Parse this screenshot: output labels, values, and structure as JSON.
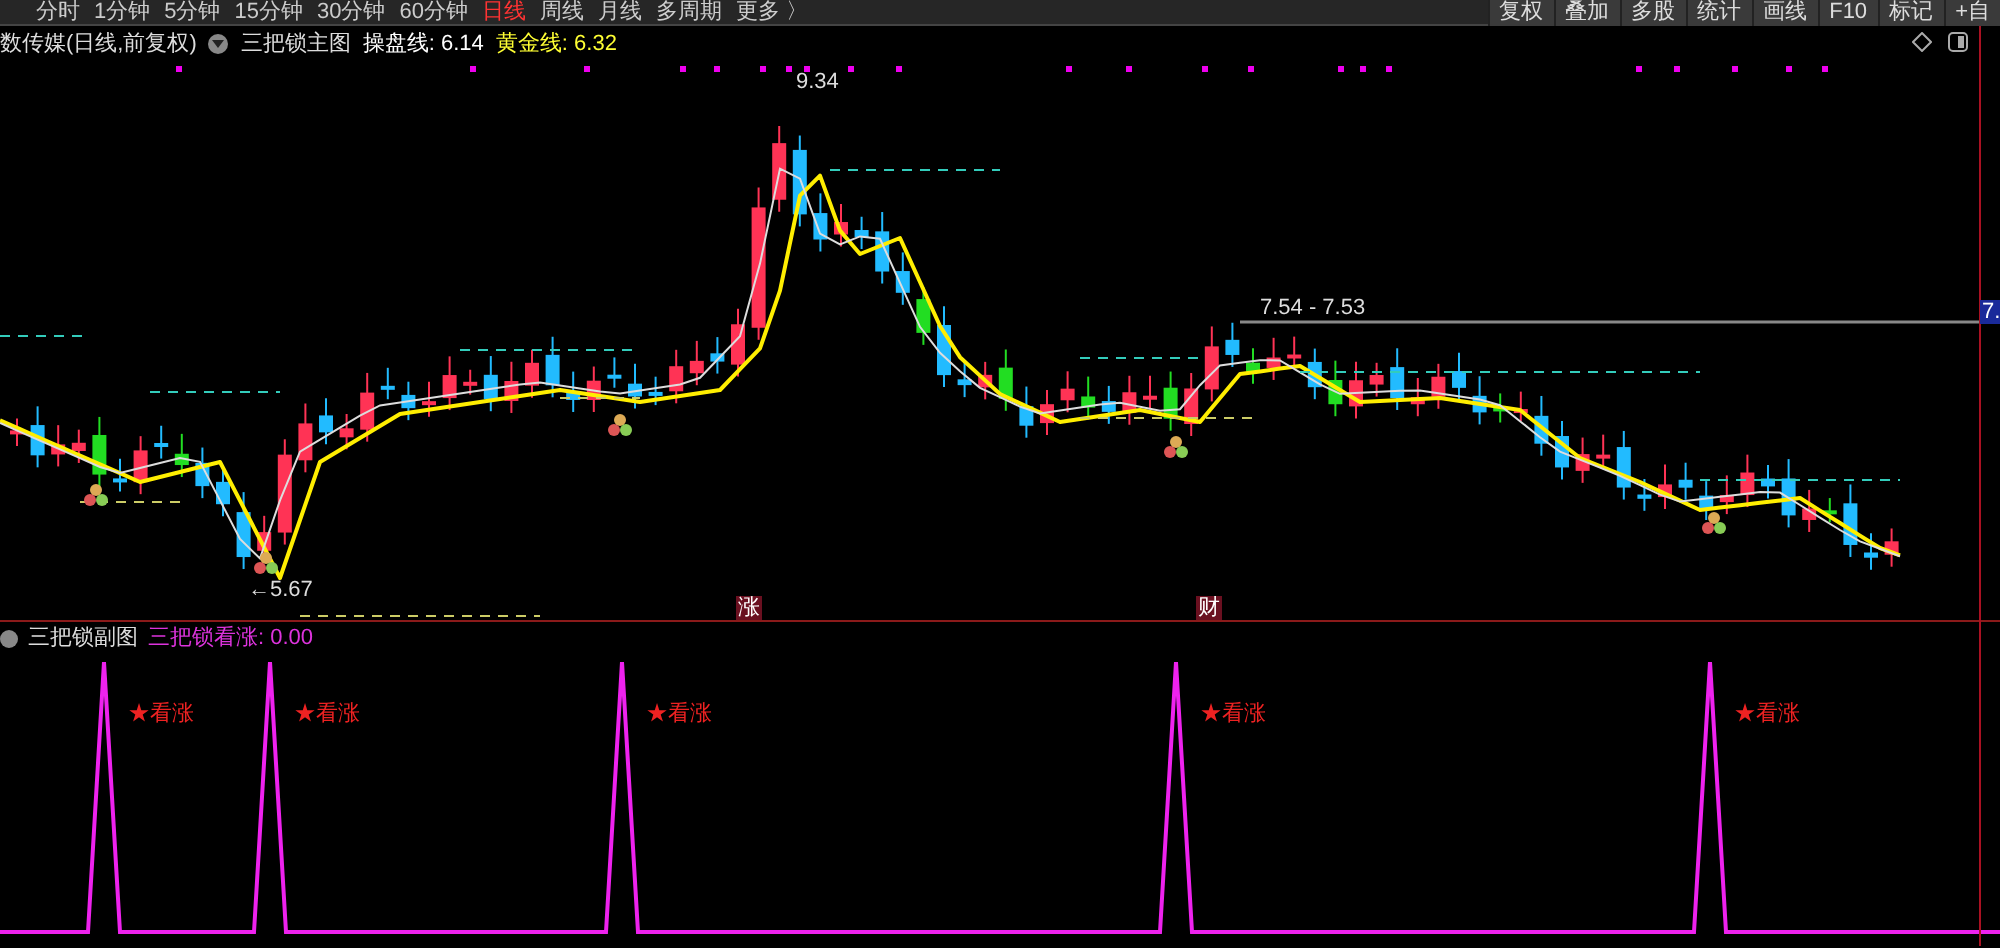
{
  "toolbar": {
    "periods": [
      {
        "label": "分时",
        "selected": false
      },
      {
        "label": "1分钟",
        "selected": false
      },
      {
        "label": "5分钟",
        "selected": false
      },
      {
        "label": "15分钟",
        "selected": false
      },
      {
        "label": "30分钟",
        "selected": false
      },
      {
        "label": "60分钟",
        "selected": false
      },
      {
        "label": "日线",
        "selected": true
      },
      {
        "label": "周线",
        "selected": false
      },
      {
        "label": "月线",
        "selected": false
      },
      {
        "label": "多周期",
        "selected": false
      },
      {
        "label": "更多 〉",
        "selected": false
      }
    ],
    "buttons": [
      "复权",
      "叠加",
      "多股",
      "统计",
      "画线",
      "F10",
      "标记",
      "+自"
    ]
  },
  "main_chart": {
    "stock_title": "数传媒(日线,前复权)",
    "indicator": "三把锁主图",
    "lines": [
      {
        "text": "操盘线: 6.14",
        "color": "#ffffff"
      },
      {
        "text": "黄金线: 6.32",
        "color": "#ffff33"
      }
    ],
    "high_label": "9.34",
    "low_label": "←5.67",
    "range_label": "7.54 - 7.53",
    "price_tag": "7.",
    "markers": [
      {
        "text": "涨"
      },
      {
        "text": "财"
      }
    ]
  },
  "sub_chart": {
    "title": "三把锁副图",
    "indicator": "三把锁看涨: 0.00",
    "signals": [
      {
        "text": "★看涨"
      },
      {
        "text": "★看涨"
      },
      {
        "text": "★看涨"
      },
      {
        "text": "★看涨"
      },
      {
        "text": "★看涨"
      }
    ]
  }
}
